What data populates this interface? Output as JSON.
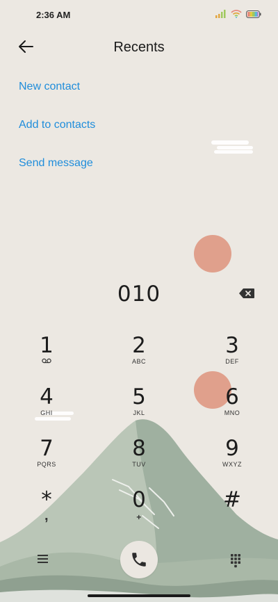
{
  "status_bar": {
    "time": "2:36 AM",
    "icons": [
      "signal-icon",
      "wifi-icon",
      "battery-icon"
    ]
  },
  "header": {
    "title": "Recents",
    "back_icon": "arrow-left-icon"
  },
  "actions": [
    "New contact",
    "Add to contacts",
    "Send message"
  ],
  "dialer": {
    "number": "010",
    "backspace_icon": "backspace-icon"
  },
  "keypad": [
    {
      "digit": "1",
      "letters": ""
    },
    {
      "digit": "2",
      "letters": "ABC"
    },
    {
      "digit": "3",
      "letters": "DEF"
    },
    {
      "digit": "4",
      "letters": "GHI"
    },
    {
      "digit": "5",
      "letters": "JKL"
    },
    {
      "digit": "6",
      "letters": "MNO"
    },
    {
      "digit": "7",
      "letters": "PQRS"
    },
    {
      "digit": "8",
      "letters": "TUV"
    },
    {
      "digit": "9",
      "letters": "WXYZ"
    },
    {
      "digit": "*",
      "letters": ","
    },
    {
      "digit": "0",
      "letters": "+"
    },
    {
      "digit": "#",
      "letters": ""
    }
  ],
  "bottom_bar": {
    "menu_icon": "hamburger-menu-icon",
    "call_icon": "phone-icon",
    "dialpad_icon": "dialpad-grid-icon"
  },
  "colors": {
    "accent": "#1f8ddb",
    "background": "#ece8e2",
    "sun": "#e0a08c",
    "mountain": "#b9c6b6"
  }
}
